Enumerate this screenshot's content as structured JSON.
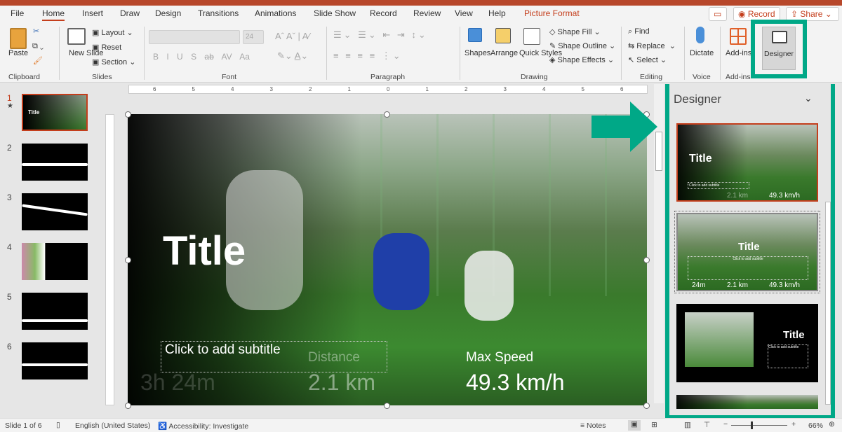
{
  "tabs": [
    "File",
    "Home",
    "Insert",
    "Draw",
    "Design",
    "Transitions",
    "Animations",
    "Slide Show",
    "Record",
    "Review",
    "View",
    "Help",
    "Picture Format"
  ],
  "active_tab": "Home",
  "top_buttons": {
    "record": "Record",
    "share": "Share"
  },
  "ribbon": {
    "clipboard": {
      "label": "Clipboard",
      "paste": "Paste"
    },
    "slides": {
      "label": "Slides",
      "new_slide": "New Slide",
      "layout": "Layout",
      "reset": "Reset",
      "section": "Section"
    },
    "font": {
      "label": "Font",
      "size": "24",
      "bold": "B",
      "italic": "I",
      "underline": "U",
      "shadow": "S",
      "strike": "ab",
      "spacing": "AV",
      "case": "Aa"
    },
    "paragraph": {
      "label": "Paragraph"
    },
    "drawing": {
      "label": "Drawing",
      "shapes": "Shapes",
      "arrange": "Arrange",
      "quick_styles": "Quick Styles",
      "shape_fill": "Shape Fill",
      "shape_outline": "Shape Outline",
      "shape_effects": "Shape Effects"
    },
    "editing": {
      "label": "Editing",
      "find": "Find",
      "replace": "Replace",
      "select": "Select"
    },
    "voice": {
      "label": "Voice",
      "dictate": "Dictate"
    },
    "addins": {
      "label": "Add-ins",
      "addins": "Add-ins"
    },
    "designer": {
      "label": "Designer"
    }
  },
  "thumbnails": [
    {
      "num": "1",
      "title": "Title",
      "selected": true
    },
    {
      "num": "2"
    },
    {
      "num": "3"
    },
    {
      "num": "4"
    },
    {
      "num": "5"
    },
    {
      "num": "6"
    }
  ],
  "ruler_ticks": [
    "6",
    "5",
    "4",
    "3",
    "2",
    "1",
    "0",
    "1",
    "2",
    "3",
    "4",
    "5",
    "6"
  ],
  "slide": {
    "title": "Title",
    "subtitle_placeholder": "Click to add subtitle",
    "time_value": "3h 24m",
    "distance_label": "Distance",
    "distance_value": "2.1 km",
    "speed_label": "Max Speed",
    "speed_value": "49.3 km/h"
  },
  "designer": {
    "title": "Designer",
    "ideas": [
      {
        "title": "Title",
        "subtitle": "Click to add subtitle",
        "values": [
          "2.1 km",
          "49.3 km/h"
        ]
      },
      {
        "title": "Title",
        "subtitle": "Click to add subtitle",
        "values": [
          "24m",
          "2.1 km",
          "49.3 km/h"
        ]
      },
      {
        "title": "Title",
        "subtitle": "Click to add subtitle"
      }
    ]
  },
  "status": {
    "slide": "Slide 1 of 6",
    "language": "English (United States)",
    "accessibility": "Accessibility: Investigate",
    "notes": "Notes",
    "zoom": "66%"
  },
  "colors": {
    "accent": "#c43e1c",
    "highlight": "#00a887"
  }
}
